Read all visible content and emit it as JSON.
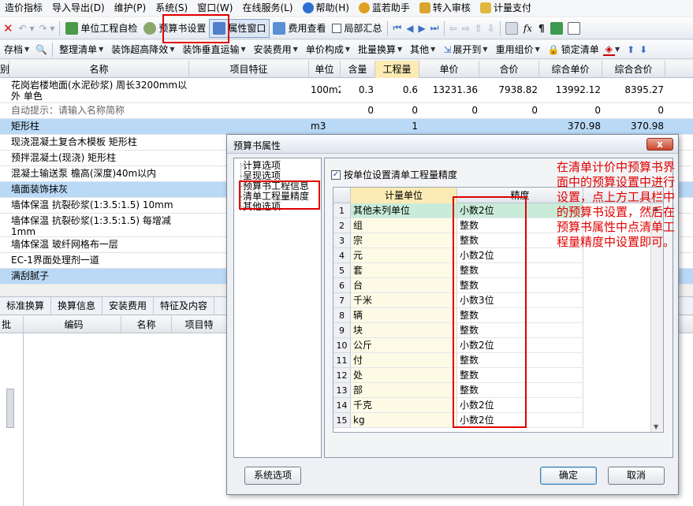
{
  "menubar": {
    "items": [
      "造价指标",
      "导入导出(D)",
      "维护(P)",
      "系统(S)",
      "窗口(W)",
      "在线服务(L)",
      "帮助(H)",
      "蓝若助手",
      "转入审核",
      "计量支付"
    ]
  },
  "toolbar": {
    "self_check": "单位工程自检",
    "budget_settings": "预算书设置",
    "property_window": "属性窗口",
    "fee_view": "费用查看",
    "partial_summary": "局部汇总"
  },
  "toolbar2": {
    "items": [
      "存档",
      "整理清单",
      "装饰超高降效",
      "装饰垂直运输",
      "安装费用",
      "单价构成",
      "批量换算",
      "其他",
      "展开到",
      "重用组价",
      "锁定清单"
    ]
  },
  "grid": {
    "headers": {
      "col_left": "别",
      "name": "名称",
      "feature": "项目特征",
      "unit": "单位",
      "content": "含量",
      "amount": "工程量",
      "unit_price": "单价",
      "total_price": "合价",
      "composite_unit": "综合单价",
      "composite_total": "综合合价"
    },
    "rows": [
      {
        "name": "花岗岩楼地面(水泥砂浆) 周长3200mm以外 单色",
        "unit": "100m2",
        "content": "0.3",
        "amount": "0.6",
        "unit_price": "13231.36",
        "total_price": "7938.82",
        "composite_unit": "13992.12",
        "composite_total": "8395.27"
      },
      {
        "name": "自动提示：请输入名称简称",
        "unit": "",
        "content": "0",
        "amount": "0",
        "unit_price": "0",
        "total_price": "0",
        "composite_unit": "0",
        "composite_total": "0"
      },
      {
        "name": "矩形柱",
        "unit": "m3",
        "content": "",
        "amount": "1",
        "unit_price": "",
        "total_price": "",
        "composite_unit": "370.98",
        "composite_total": "370.98"
      },
      {
        "name": "现浇混凝土复合木模板 矩形柱"
      },
      {
        "name": "预拌混凝土(现浇) 矩形柱"
      },
      {
        "name": "混凝土输送泵 檐高(深度)40m以内"
      },
      {
        "name": "墙面装饰抹灰"
      },
      {
        "name": "墙体保温 抗裂砂浆(1:3.5:1.5) 10mm"
      },
      {
        "name": "墙体保温 抗裂砂浆(1:3.5:1.5) 每增减1mm"
      },
      {
        "name": "墙体保温 玻纤网格布一层"
      },
      {
        "name": "EC-1界面处理剂一道"
      },
      {
        "name": "满刮腻子"
      }
    ]
  },
  "lower": {
    "tabs": [
      "标准换算",
      "换算信息",
      "安装费用",
      "特征及内容"
    ],
    "col_left": "批",
    "headers": {
      "code": "编码",
      "name": "名称",
      "feature": "项目特"
    }
  },
  "dialog": {
    "title": "预算书属性",
    "close": "x",
    "tree": [
      "计算选项",
      "呈现选项",
      "预算书工程信息",
      "清单工程量精度",
      "其他选项"
    ],
    "checkbox_label": "按单位设置清单工程量精度",
    "table": {
      "col_unit": "计量单位",
      "col_precision": "精度",
      "rows": [
        {
          "no": "1",
          "unit": "其他未列单位",
          "precision": "小数2位"
        },
        {
          "no": "2",
          "unit": "组",
          "precision": "整数"
        },
        {
          "no": "3",
          "unit": "宗",
          "precision": "整数"
        },
        {
          "no": "4",
          "unit": "元",
          "precision": "小数2位"
        },
        {
          "no": "5",
          "unit": "套",
          "precision": "整数"
        },
        {
          "no": "6",
          "unit": "台",
          "precision": "整数"
        },
        {
          "no": "7",
          "unit": "千米",
          "precision": "小数3位"
        },
        {
          "no": "8",
          "unit": "辆",
          "precision": "整数"
        },
        {
          "no": "9",
          "unit": "块",
          "precision": "整数"
        },
        {
          "no": "10",
          "unit": "公斤",
          "precision": "小数2位"
        },
        {
          "no": "11",
          "unit": "付",
          "precision": "整数"
        },
        {
          "no": "12",
          "unit": "处",
          "precision": "整数"
        },
        {
          "no": "13",
          "unit": "部",
          "precision": "整数"
        },
        {
          "no": "14",
          "unit": "千克",
          "precision": "小数2位"
        },
        {
          "no": "15",
          "unit": "kg",
          "precision": "小数2位"
        }
      ]
    },
    "system_options": "系统选项",
    "ok": "确定",
    "cancel": "取消"
  },
  "annotation": "在清单计价中预算书界面中的预算设置中进行设置，点上方工具栏中的预算书设置，然后在预算书属性中点清单工程量精度中设置即可。",
  "colors": {
    "highlight_red": "#e00000",
    "row_blue": "#b9d9f6",
    "amount_yellow": "#fcebb4",
    "selected_green": "#c9ecd9"
  }
}
